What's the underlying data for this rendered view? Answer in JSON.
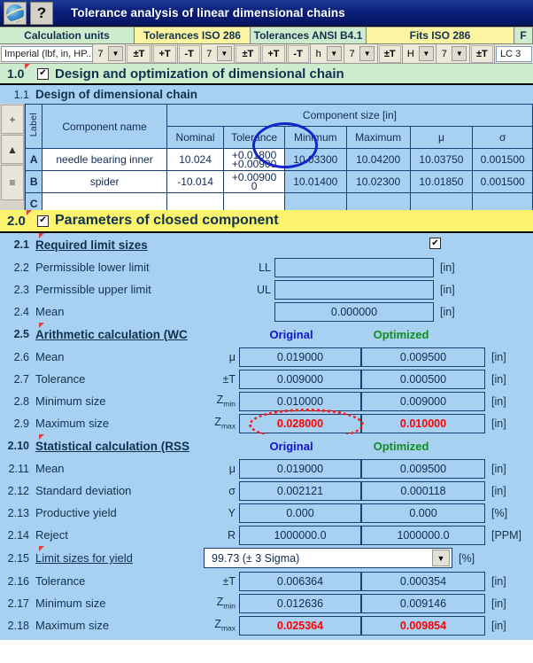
{
  "window": {
    "title": "Tolerance analysis of linear dimensional chains",
    "icon_button": "browser-icon",
    "help_button": "?"
  },
  "toolbar": {
    "groups": [
      {
        "label": "Calculation units",
        "style": "green"
      },
      {
        "label": "Tolerances ISO 286",
        "style": "yellow"
      },
      {
        "label": "Tolerances ANSI B4.1",
        "style": "green"
      },
      {
        "label": "Fits ISO 286",
        "style": "yellow"
      },
      {
        "label": "F",
        "style": "green"
      }
    ],
    "units_value": "Imperial (lbf, in, HP...",
    "iso_grade": "7",
    "iso_buttons": [
      "±T",
      "+T",
      "-T"
    ],
    "ansi_grade": "7",
    "ansi_buttons": [
      "±T",
      "+T",
      "-T"
    ],
    "fit_shaft_letter": "h",
    "fit_shaft_grade": "7",
    "fit_shaft_btn": "±T",
    "fit_hole_letter": "H",
    "fit_hole_grade": "7",
    "fit_hole_btn": "±T",
    "fit_right_value": "LC 3"
  },
  "section1": {
    "number": "1.0",
    "title": "Design and optimization of dimensional chain",
    "checked": true,
    "sub": {
      "number": "1.1",
      "title": "Design of dimensional chain"
    }
  },
  "table": {
    "label_header": "Label",
    "name_header": "Component name",
    "group_header": "Component size [in]",
    "columns": [
      "Nominal",
      "Tolerance",
      "Minimum",
      "Maximum",
      "μ",
      "σ"
    ],
    "rows": [
      {
        "label": "A",
        "name": "needle bearing inner",
        "nominal": "10.024",
        "tolerance_upper": "+0.01800",
        "tolerance_lower": "+0.00900",
        "minimum": "10.03300",
        "maximum": "10.04200",
        "mu": "10.03750",
        "sigma": "0.001500"
      },
      {
        "label": "B",
        "name": "spider",
        "nominal": "-10.014",
        "tolerance_upper": "+0.00900",
        "tolerance_lower": "0",
        "minimum": "10.01400",
        "maximum": "10.02300",
        "mu": "10.01850",
        "sigma": "0.001500"
      },
      {
        "label": "C",
        "name": "",
        "nominal": "",
        "tolerance_upper": "",
        "tolerance_lower": "",
        "minimum": "",
        "maximum": "",
        "mu": "",
        "sigma": ""
      }
    ],
    "rail_buttons": [
      "+",
      "▲",
      "≡"
    ]
  },
  "section2": {
    "number": "2.0",
    "title": "Parameters of closed component",
    "checked": true,
    "col_original": "Original",
    "col_optimized": "Optimized",
    "rows": [
      {
        "num": "2.1",
        "label": "Required limit sizes",
        "kind": "headerchk",
        "checked": true
      },
      {
        "num": "2.2",
        "label": "Permissible lower limit",
        "sym": "LL",
        "kind": "single",
        "value": "",
        "unit": "[in]"
      },
      {
        "num": "2.3",
        "label": "Permissible upper limit",
        "sym": "UL",
        "kind": "single",
        "value": "",
        "unit": "[in]"
      },
      {
        "num": "2.4",
        "label": "Mean",
        "sym": "",
        "kind": "single",
        "value": "0.000000",
        "unit": "[in]"
      },
      {
        "num": "2.5",
        "label": "Arithmetic calculation (WC",
        "kind": "subheader"
      },
      {
        "num": "2.6",
        "label": "Mean",
        "sym": "μ",
        "kind": "pair",
        "original": "0.019000",
        "optimized": "0.009500",
        "unit": "[in]"
      },
      {
        "num": "2.7",
        "label": "Tolerance",
        "sym": "±T",
        "kind": "pair",
        "original": "0.009000",
        "optimized": "0.000500",
        "unit": "[in]"
      },
      {
        "num": "2.8",
        "label": "Minimum size",
        "sym": "Zmin",
        "kind": "pair",
        "original": "0.010000",
        "optimized": "0.009000",
        "unit": "[in]"
      },
      {
        "num": "2.9",
        "label": "Maximum size",
        "sym": "Zmax",
        "kind": "pair",
        "original": "0.028000",
        "optimized": "0.010000",
        "unit": "[in]",
        "red": true
      },
      {
        "num": "2.10",
        "label": "Statistical calculation (RSS",
        "kind": "subheader"
      },
      {
        "num": "2.11",
        "label": "Mean",
        "sym": "μ",
        "kind": "pair",
        "original": "0.019000",
        "optimized": "0.009500",
        "unit": "[in]"
      },
      {
        "num": "2.12",
        "label": "Standard deviation",
        "sym": "σ",
        "kind": "pair",
        "original": "0.002121",
        "optimized": "0.000118",
        "unit": "[in]"
      },
      {
        "num": "2.13",
        "label": "Productive yield",
        "sym": "Y",
        "kind": "pair",
        "original": "0.000",
        "optimized": "0.000",
        "unit": "[%]"
      },
      {
        "num": "2.14",
        "label": "Reject",
        "sym": "R",
        "kind": "pair",
        "original": "1000000.0",
        "optimized": "1000000.0",
        "unit": "[PPM]"
      },
      {
        "num": "2.15",
        "label": "Limit sizes for yield",
        "kind": "dropdown",
        "value": "99.73  (± 3 Sigma)",
        "unit": "[%]"
      },
      {
        "num": "2.16",
        "label": "Tolerance",
        "sym": "±T",
        "kind": "pair",
        "original": "0.006364",
        "optimized": "0.000354",
        "unit": "[in]"
      },
      {
        "num": "2.17",
        "label": "Minimum size",
        "sym": "Zmin",
        "kind": "pair",
        "original": "0.012636",
        "optimized": "0.009146",
        "unit": "[in]"
      },
      {
        "num": "2.18",
        "label": "Maximum size",
        "sym": "Zmax",
        "kind": "pair",
        "original": "0.025364",
        "optimized": "0.009854",
        "unit": "[in]",
        "red": true
      }
    ]
  },
  "colors": {
    "titlebar": "#0a1f7a",
    "section_green": "#cdeccd",
    "section_yellow": "#fbf46c",
    "panel_blue": "#a8d0f0",
    "original_label": "#1414cf",
    "optimized_label": "#0f8f1f",
    "alert_red": "#ff0000",
    "annotation_blue": "#1324c8",
    "annotation_red": "#f02020"
  }
}
